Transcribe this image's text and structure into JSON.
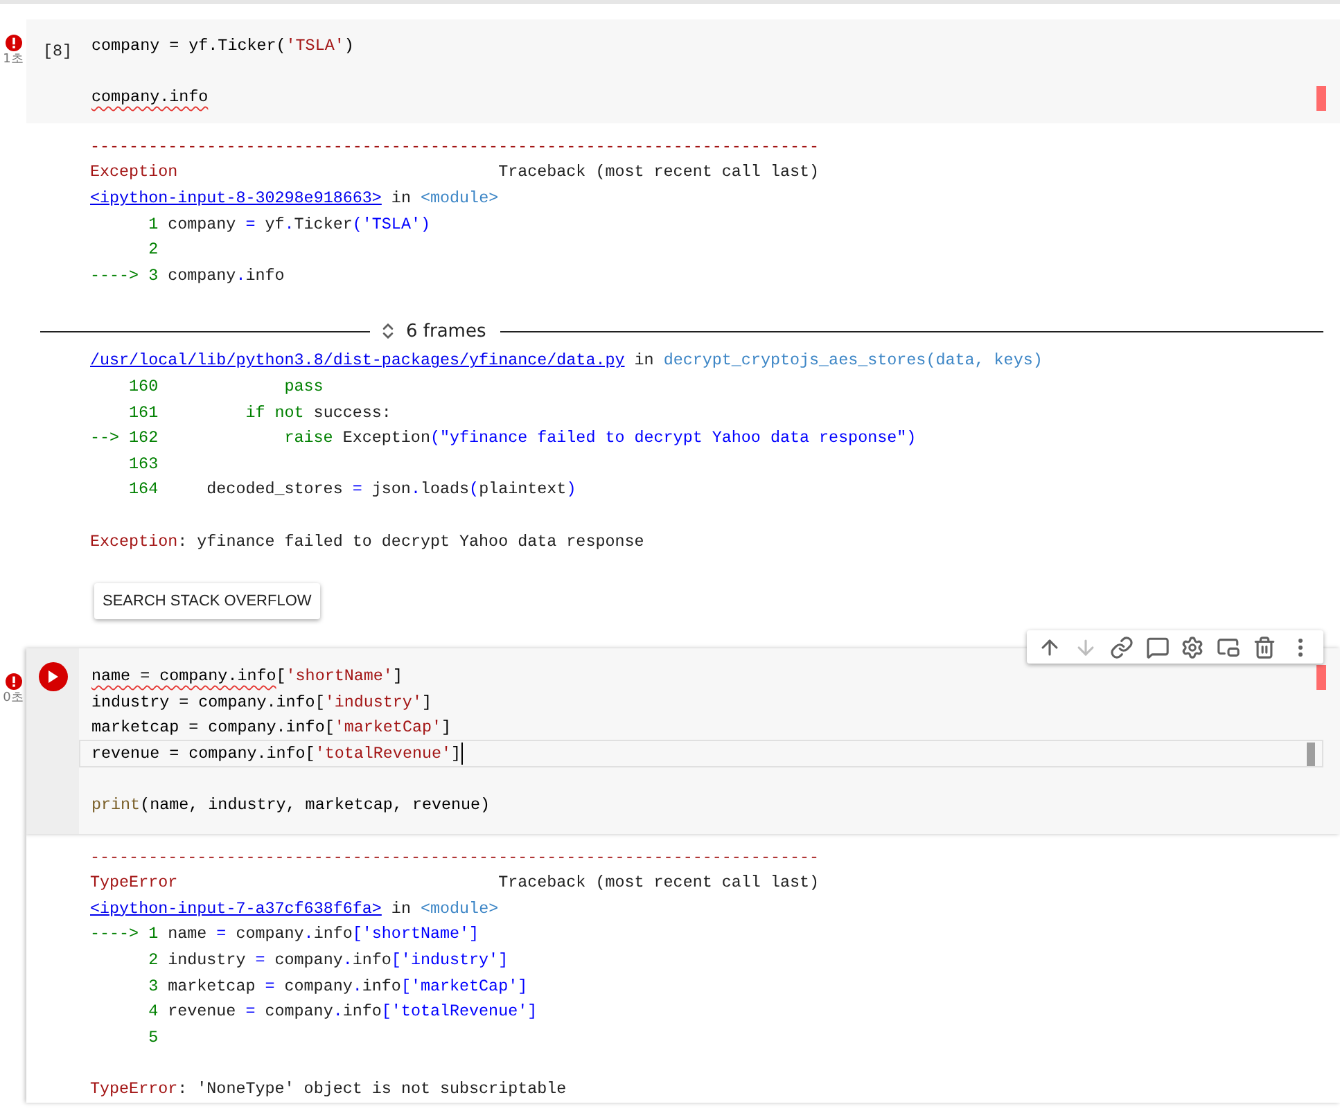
{
  "cells": [
    {
      "error": true,
      "time": "1초",
      "gutter": {
        "kind": "count",
        "label": "[8]"
      },
      "code": [
        {
          "kind": "code",
          "current": false,
          "tokens": [
            {
              "kind": "plain",
              "text": "company = yf.Ticker(",
              "squiggle": false
            },
            {
              "kind": "str",
              "text": "'TSLA'",
              "squiggle": false
            },
            {
              "kind": "plain",
              "text": ")",
              "squiggle": false
            }
          ]
        },
        {
          "kind": "blank"
        },
        {
          "kind": "code",
          "current": false,
          "tokens": [
            {
              "kind": "plain",
              "text": "company.info",
              "squiggle": true
            }
          ]
        }
      ],
      "output": [
        {
          "kind": "rule",
          "text": "---------------------------------------------------------------------------"
        },
        {
          "kind": "header",
          "name": "Exception",
          "note": "Traceback (most recent call last)"
        },
        {
          "kind": "line",
          "tokens": [
            {
              "kind": "link",
              "text": "<ipython-input-8-30298e918663>"
            },
            {
              "kind": "plain",
              "text": " in "
            },
            {
              "kind": "mod",
              "text": "<module>"
            }
          ]
        },
        {
          "kind": "src",
          "no": "1",
          "tokens": [
            {
              "kind": "plain",
              "text": "company "
            },
            {
              "kind": "op",
              "text": "="
            },
            {
              "kind": "plain",
              "text": " yf"
            },
            {
              "kind": "op",
              "text": "."
            },
            {
              "kind": "plain",
              "text": "Ticker"
            },
            {
              "kind": "op",
              "text": "("
            },
            {
              "kind": "str",
              "text": "'TSLA'"
            },
            {
              "kind": "op",
              "text": ")"
            }
          ]
        },
        {
          "kind": "src",
          "no": "2"
        },
        {
          "kind": "src",
          "marker": "---->",
          "no": "3",
          "tokens": [
            {
              "kind": "plain",
              "text": "company"
            },
            {
              "kind": "op",
              "text": "."
            },
            {
              "kind": "plain",
              "text": "info"
            }
          ]
        },
        {
          "kind": "frames",
          "label": "6 frames"
        },
        {
          "kind": "line",
          "tokens": [
            {
              "kind": "link",
              "text": "/usr/local/lib/python3.8/dist-packages/yfinance/data.py"
            },
            {
              "kind": "plain",
              "text": " in "
            },
            {
              "kind": "mod",
              "text": "decrypt_cryptojs_aes_stores(data, keys)"
            }
          ]
        },
        {
          "kind": "src",
          "no": "160",
          "tokens": [
            {
              "kind": "kw",
              "text": "            pass"
            }
          ]
        },
        {
          "kind": "src",
          "no": "161",
          "tokens": [
            {
              "kind": "kw",
              "text": "        if not"
            },
            {
              "kind": "plain",
              "text": " success:"
            }
          ]
        },
        {
          "kind": "src",
          "marker": "-->",
          "no": "162",
          "tokens": [
            {
              "kind": "kw",
              "text": "            raise"
            },
            {
              "kind": "plain",
              "text": " Exception"
            },
            {
              "kind": "op",
              "text": "("
            },
            {
              "kind": "str",
              "text": "\"yfinance failed to decrypt Yahoo data response\""
            },
            {
              "kind": "op",
              "text": ")"
            }
          ]
        },
        {
          "kind": "src",
          "no": "163"
        },
        {
          "kind": "src",
          "no": "164",
          "tokens": [
            {
              "kind": "plain",
              "text": "    decoded_stores "
            },
            {
              "kind": "op",
              "text": "="
            },
            {
              "kind": "plain",
              "text": " json"
            },
            {
              "kind": "op",
              "text": "."
            },
            {
              "kind": "plain",
              "text": "loads"
            },
            {
              "kind": "op",
              "text": "("
            },
            {
              "kind": "plain",
              "text": "plaintext"
            },
            {
              "kind": "op",
              "text": ")"
            }
          ]
        },
        {
          "kind": "blank"
        },
        {
          "kind": "line",
          "tokens": [
            {
              "kind": "err",
              "text": "Exception"
            },
            {
              "kind": "plain",
              "text": ": yfinance failed to decrypt Yahoo data response"
            }
          ]
        },
        {
          "kind": "button",
          "label": "SEARCH STACK OVERFLOW"
        }
      ]
    },
    {
      "error": true,
      "time": "0초",
      "gutter": {
        "kind": "run"
      },
      "toolbar": [
        {
          "kind": "up",
          "disabled": false
        },
        {
          "kind": "down",
          "disabled": true
        },
        {
          "kind": "link",
          "disabled": false
        },
        {
          "kind": "comment",
          "disabled": false
        },
        {
          "kind": "settings",
          "disabled": false
        },
        {
          "kind": "mirror",
          "disabled": false
        },
        {
          "kind": "delete",
          "disabled": false
        },
        {
          "kind": "more",
          "disabled": false
        }
      ],
      "code": [
        {
          "kind": "code",
          "current": false,
          "tokens": [
            {
              "kind": "plain",
              "text": "name = company.info",
              "squiggle": true
            },
            {
              "kind": "plain",
              "text": "[",
              "squiggle": false
            },
            {
              "kind": "str",
              "text": "'shortName'",
              "squiggle": false
            },
            {
              "kind": "plain",
              "text": "]",
              "squiggle": false
            }
          ]
        },
        {
          "kind": "code",
          "current": false,
          "tokens": [
            {
              "kind": "plain",
              "text": "industry = company.info[",
              "squiggle": false
            },
            {
              "kind": "str",
              "text": "'industry'",
              "squiggle": false
            },
            {
              "kind": "plain",
              "text": "]",
              "squiggle": false
            }
          ]
        },
        {
          "kind": "code",
          "current": false,
          "tokens": [
            {
              "kind": "plain",
              "text": "marketcap = company.info[",
              "squiggle": false
            },
            {
              "kind": "str",
              "text": "'marketCap'",
              "squiggle": false
            },
            {
              "kind": "plain",
              "text": "]",
              "squiggle": false
            }
          ]
        },
        {
          "kind": "code",
          "current": true,
          "tokens": [
            {
              "kind": "plain",
              "text": "revenue = company.info[",
              "squiggle": false
            },
            {
              "kind": "str",
              "text": "'totalRevenue'",
              "squiggle": false
            },
            {
              "kind": "plain",
              "text": "]",
              "squiggle": false
            }
          ]
        },
        {
          "kind": "blank"
        },
        {
          "kind": "code",
          "current": false,
          "tokens": [
            {
              "kind": "fn",
              "text": "print",
              "squiggle": false
            },
            {
              "kind": "plain",
              "text": "(name, industry, marketcap, revenue)",
              "squiggle": false
            }
          ]
        }
      ],
      "output": [
        {
          "kind": "rule",
          "text": "---------------------------------------------------------------------------"
        },
        {
          "kind": "header",
          "name": "TypeError",
          "note": "Traceback (most recent call last)"
        },
        {
          "kind": "line",
          "tokens": [
            {
              "kind": "link",
              "text": "<ipython-input-7-a37cf638f6fa>"
            },
            {
              "kind": "plain",
              "text": " in "
            },
            {
              "kind": "mod",
              "text": "<module>"
            }
          ]
        },
        {
          "kind": "src",
          "marker": "---->",
          "no": "1",
          "tokens": [
            {
              "kind": "plain",
              "text": "name "
            },
            {
              "kind": "op",
              "text": "="
            },
            {
              "kind": "plain",
              "text": " company"
            },
            {
              "kind": "op",
              "text": "."
            },
            {
              "kind": "plain",
              "text": "info"
            },
            {
              "kind": "str",
              "text": "['shortName']"
            }
          ]
        },
        {
          "kind": "src",
          "no": "2",
          "tokens": [
            {
              "kind": "plain",
              "text": "industry "
            },
            {
              "kind": "op",
              "text": "="
            },
            {
              "kind": "plain",
              "text": " company"
            },
            {
              "kind": "op",
              "text": "."
            },
            {
              "kind": "plain",
              "text": "info"
            },
            {
              "kind": "str",
              "text": "['industry']"
            }
          ]
        },
        {
          "kind": "src",
          "no": "3",
          "tokens": [
            {
              "kind": "plain",
              "text": "marketcap "
            },
            {
              "kind": "op",
              "text": "="
            },
            {
              "kind": "plain",
              "text": " company"
            },
            {
              "kind": "op",
              "text": "."
            },
            {
              "kind": "plain",
              "text": "info"
            },
            {
              "kind": "str",
              "text": "['marketCap']"
            }
          ]
        },
        {
          "kind": "src",
          "no": "4",
          "tokens": [
            {
              "kind": "plain",
              "text": "revenue "
            },
            {
              "kind": "op",
              "text": "="
            },
            {
              "kind": "plain",
              "text": " company"
            },
            {
              "kind": "op",
              "text": "."
            },
            {
              "kind": "plain",
              "text": "info"
            },
            {
              "kind": "str",
              "text": "['totalRevenue']"
            }
          ]
        },
        {
          "kind": "src",
          "no": "5"
        },
        {
          "kind": "blank"
        },
        {
          "kind": "line",
          "tokens": [
            {
              "kind": "err",
              "text": "TypeError"
            },
            {
              "kind": "plain",
              "text": ": 'NoneType' object is not subscriptable"
            }
          ]
        }
      ]
    }
  ]
}
